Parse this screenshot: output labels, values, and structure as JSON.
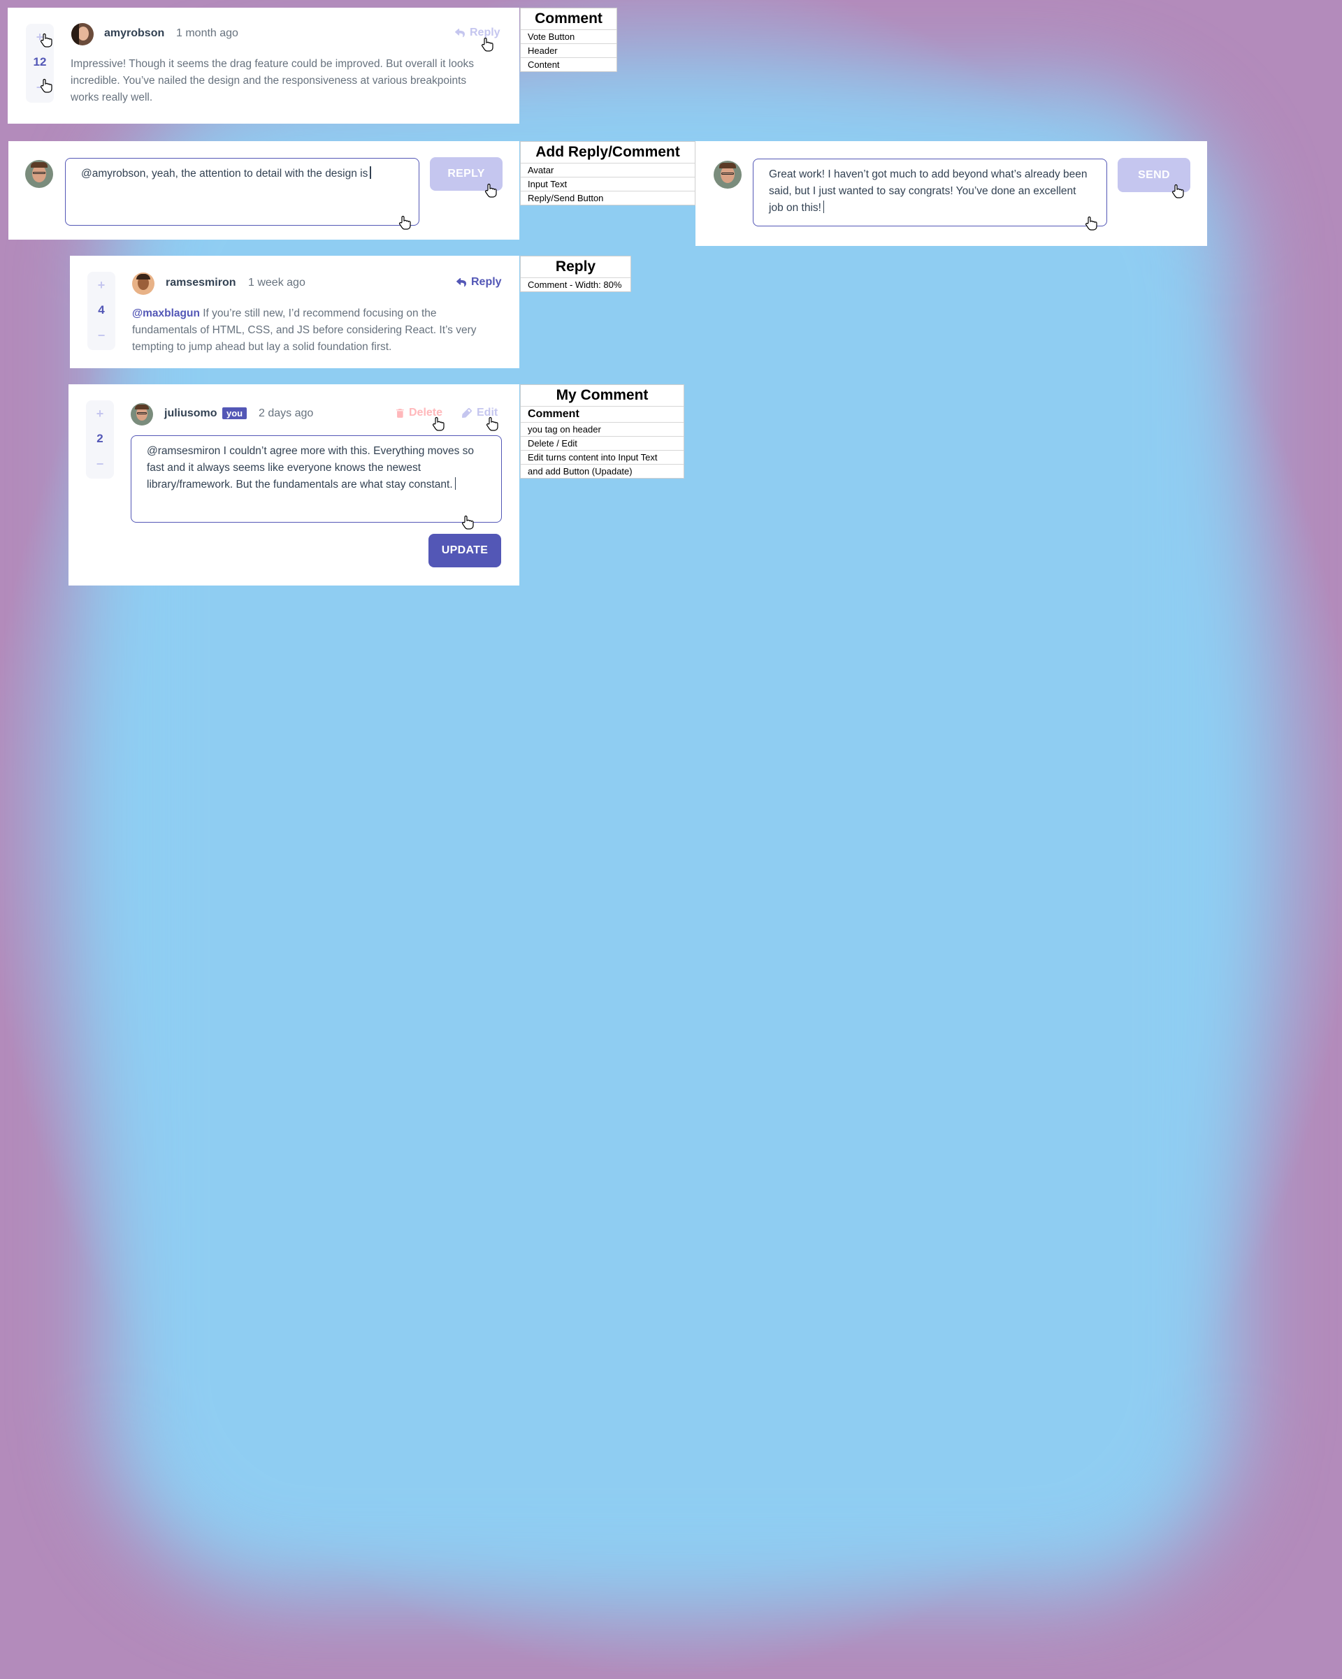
{
  "colors": {
    "moderate_blue": "#5357b6",
    "light_grayish_blue": "#c5c6ef",
    "soft_red": "#ed6368",
    "pale_red": "#ffb8bb",
    "dark_blue": "#334253",
    "grayish_blue": "#67727e",
    "background_blue": "#8ecdf2",
    "background_purple": "#b38bbb"
  },
  "comment": {
    "plus": "+",
    "minus": "−",
    "score": "12",
    "username": "amyrobson",
    "time": "1 month ago",
    "reply_label": "Reply",
    "reply_icon": "reply-icon",
    "content": "Impressive! Though it seems the drag feature could be improved. But overall it looks incredible. You’ve nailed the design and the responsiveness at various breakpoints works really well."
  },
  "note_comment": {
    "title": "Comment",
    "rows": [
      "Vote Button",
      "Header",
      "Content"
    ]
  },
  "add_reply": {
    "text": "@amyrobson, yeah, the attention to detail with the design is",
    "button_label": "REPLY"
  },
  "note_add": {
    "title": "Add Reply/Comment",
    "rows": [
      "Avatar",
      "Input Text",
      "Reply/Send Button"
    ]
  },
  "add_comment": {
    "text": "Great work! I haven’t got much to add beyond what’s already been said, but I just wanted to say congrats! You’ve done an excellent job on this!",
    "button_label": "SEND"
  },
  "reply": {
    "plus": "+",
    "minus": "−",
    "score": "4",
    "username": "ramsesmiron",
    "time": "1 week ago",
    "reply_label": "Reply",
    "mention": "@maxblagun",
    "content": "If you’re still new, I’d recommend focusing on the fundamentals of HTML, CSS, and JS before considering React. It’s very tempting to jump ahead but lay a solid foundation first."
  },
  "note_reply": {
    "title": "Reply",
    "rows": [
      "Comment - Width: 80%"
    ]
  },
  "my_comment": {
    "plus": "+",
    "minus": "−",
    "score": "2",
    "username": "juliusomo",
    "you_tag": "you",
    "time": "2 days ago",
    "delete_label": "Delete",
    "edit_label": "Edit",
    "text": "@ramsesmiron I couldn’t agree more with this. Everything moves so fast and it always seems like everyone knows the newest library/framework. But the fundamentals are what stay constant.",
    "update_label": "UPDATE"
  },
  "note_my": {
    "title": "My Comment",
    "subtitle": "Comment",
    "rows": [
      "you tag on header",
      "Delete / Edit",
      "Edit turns content into Input Text",
      "and add Button (Upadate)"
    ]
  }
}
